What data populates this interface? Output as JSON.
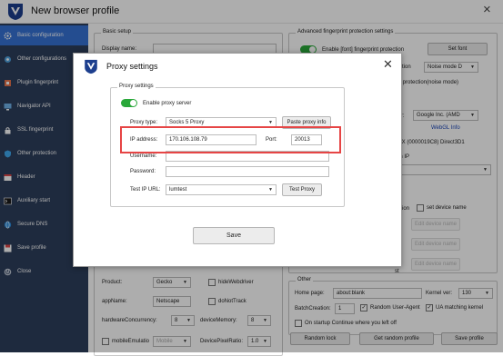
{
  "window": {
    "title": "New browser profile",
    "close_icon": "×"
  },
  "sidebar": {
    "items": [
      {
        "label": "Basic configuration",
        "active": true,
        "icon": "gear-icon"
      },
      {
        "label": "Other configurations",
        "active": false,
        "icon": "tools-icon"
      },
      {
        "label": "Plugin fingerprint",
        "active": false,
        "icon": "plugin-icon"
      },
      {
        "label": "Navigator API",
        "active": false,
        "icon": "monitor-icon"
      },
      {
        "label": "SSL fingerprint",
        "active": false,
        "icon": "lock-icon"
      },
      {
        "label": "Other protection",
        "active": false,
        "icon": "shield-icon"
      },
      {
        "label": "Header",
        "active": false,
        "icon": "header-icon"
      },
      {
        "label": "Auxiliary start",
        "active": false,
        "icon": "cmd-icon"
      },
      {
        "label": "Secure DNS",
        "active": false,
        "icon": "globe-icon"
      },
      {
        "label": "Save profile",
        "active": false,
        "icon": "save-icon"
      },
      {
        "label": "Close",
        "active": false,
        "icon": "power-icon"
      }
    ]
  },
  "basic_setup": {
    "legend": "Basic setup",
    "display_name_label": "Display name:",
    "display_name_value": ""
  },
  "advanced": {
    "legend": "Advanced fingerprint protection settings",
    "enable_font_label": "Enable [font] fingerprint protection",
    "set_font_button": "Set font",
    "frag1": "tection",
    "noise_mode_value": "Noise mode D",
    "frag2": "nt  protection(noise mode)",
    "frag3": "dor:",
    "vendor_value": "Google Inc. (AMD",
    "webgl_info_link": "WebGL Info",
    "renderer_value": "XTX (0000019C8) Direct3D1",
    "frag4": "on IP",
    "frag5": "ection",
    "set_device_name_label": "set device name",
    "edit_device_buttons": [
      "Edit device name",
      "Edit device name",
      "Edit device name"
    ],
    "frag6": "st"
  },
  "hardware": {
    "product_label": "Product:",
    "product_value": "Gecko",
    "hide_webdriver_label": "hideWebdriver",
    "appname_label": "appName:",
    "appname_value": "Netscape",
    "dnt_label": "doNotTrack",
    "concurrency_label": "hardwareConcurrency:",
    "concurrency_value": "8",
    "memory_label": "deviceMemory:",
    "memory_value": "8",
    "mobile_label": "mobileEmulatio",
    "mobile_value": "Mobile",
    "pixel_ratio_label": "DevicePixelRatio:",
    "pixel_ratio_value": "1.0"
  },
  "other": {
    "legend": "Other",
    "home_label": "Home page:",
    "home_value": "about:blank",
    "kernel_label": "Kernel ver:",
    "kernel_value": "130",
    "batch_label": "BatchCreation:",
    "batch_value": "1",
    "random_ua_label": "Random User-Agent",
    "ua_matching_label": "UA matching kernel",
    "startup_label": "On startup Continue where you left off"
  },
  "bottom_buttons": {
    "random_lock": "Random lock",
    "get_random_profile": "Get random profile",
    "save_profile": "Save profile"
  },
  "dialog": {
    "title": "Proxy settings",
    "close_icon": "✕",
    "legend": "Proxy settings",
    "enable_proxy_label": "Enable proxy server",
    "proxy_type_label": "Proxy type:",
    "proxy_type_value": "Socks 5 Proxy",
    "paste_button": "Paste proxy info",
    "ip_label": "IP address:",
    "ip_value": "170.106.108.79",
    "port_label": "Port:",
    "port_value": "20013",
    "username_label": "Username:",
    "username_value": "",
    "password_label": "Password:",
    "password_value": "",
    "test_url_label": "Test IP URL:",
    "test_url_value": "lumtest",
    "test_button": "Test Proxy",
    "save_button": "Save",
    "highlight_color": "#e64545"
  },
  "colors": {
    "sidebar_bg": "#2d3e5c",
    "sidebar_active": "#3672d4",
    "toggle_on": "#2aa83a",
    "link": "#1b47b8"
  }
}
